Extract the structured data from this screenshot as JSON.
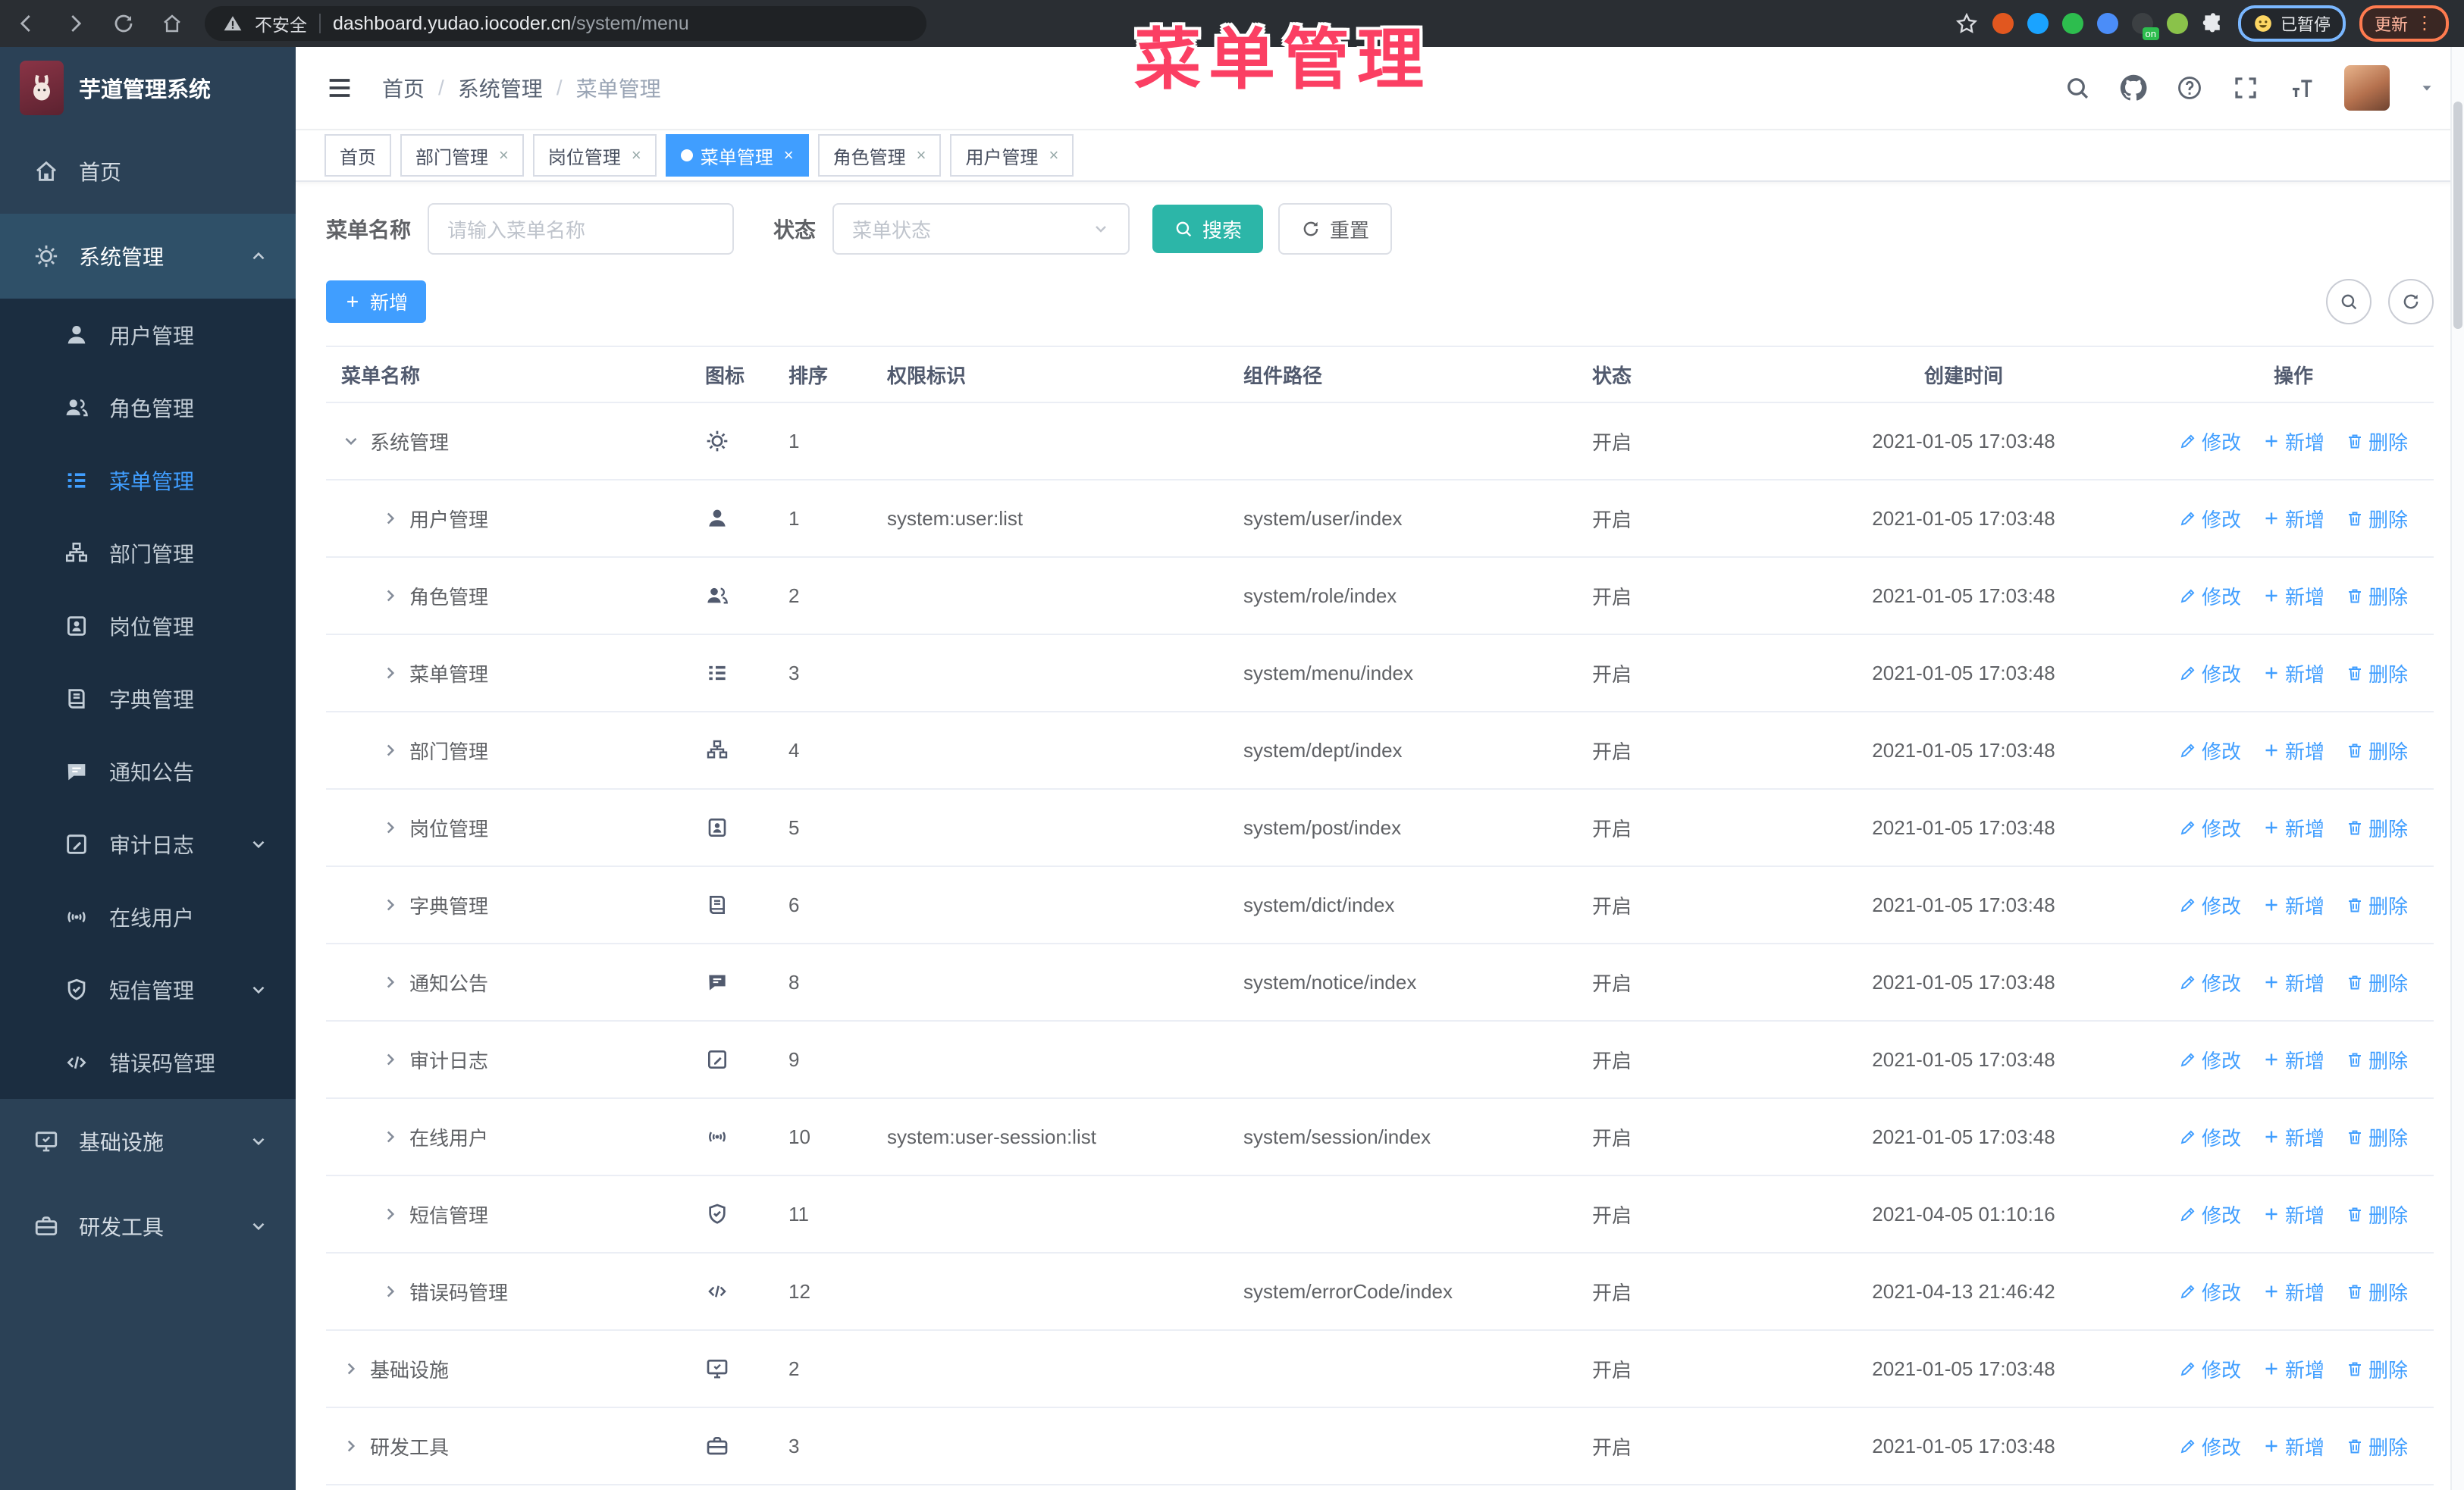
{
  "annotation": {
    "text": "菜单管理"
  },
  "browser": {
    "secure_label": "不安全",
    "url_host": "dashboard.yudao.iocoder.cn",
    "url_path": "/system/menu",
    "paused_label": "已暂停",
    "update_label": "更新",
    "extensions": [
      {
        "name": "ubuntu-extension-icon",
        "color": "#e1571f"
      },
      {
        "name": "gem-extension-icon",
        "color": "#1aa3ff"
      },
      {
        "name": "check-extension-icon",
        "color": "#2dbd4e"
      },
      {
        "name": "tabs-extension-icon",
        "color": "#4b8df8"
      },
      {
        "name": "screenshot-extension-icon",
        "color": "#3c4043",
        "badge": "on"
      },
      {
        "name": "bot-extension-icon",
        "color": "#8ac24a"
      }
    ]
  },
  "sidebar": {
    "app_title": "芋道管理系统",
    "items": [
      {
        "label": "首页",
        "icon": "home",
        "type": "top"
      },
      {
        "label": "系统管理",
        "icon": "gear",
        "type": "top",
        "open": true,
        "chevron": "up"
      },
      {
        "label": "用户管理",
        "icon": "user",
        "type": "sub"
      },
      {
        "label": "角色管理",
        "icon": "users",
        "type": "sub"
      },
      {
        "label": "菜单管理",
        "icon": "menu",
        "type": "sub",
        "active": true
      },
      {
        "label": "部门管理",
        "icon": "tree",
        "type": "sub"
      },
      {
        "label": "岗位管理",
        "icon": "badge",
        "type": "sub"
      },
      {
        "label": "字典管理",
        "icon": "book",
        "type": "sub"
      },
      {
        "label": "通知公告",
        "icon": "chat",
        "type": "sub"
      },
      {
        "label": "审计日志",
        "icon": "editlog",
        "type": "sub",
        "chevron": "down"
      },
      {
        "label": "在线用户",
        "icon": "online",
        "type": "sub"
      },
      {
        "label": "短信管理",
        "icon": "shield",
        "type": "sub",
        "chevron": "down"
      },
      {
        "label": "错误码管理",
        "icon": "code",
        "type": "sub"
      },
      {
        "label": "基础设施",
        "icon": "monitor",
        "type": "top",
        "chevron": "down"
      },
      {
        "label": "研发工具",
        "icon": "tool",
        "type": "top",
        "chevron": "down"
      }
    ]
  },
  "header": {
    "breadcrumb": [
      "首页",
      "系统管理",
      "菜单管理"
    ]
  },
  "tabs": [
    {
      "label": "首页"
    },
    {
      "label": "部门管理",
      "closable": true
    },
    {
      "label": "岗位管理",
      "closable": true
    },
    {
      "label": "菜单管理",
      "closable": true,
      "active": true
    },
    {
      "label": "角色管理",
      "closable": true
    },
    {
      "label": "用户管理",
      "closable": true
    }
  ],
  "filters": {
    "name_label": "菜单名称",
    "name_placeholder": "请输入菜单名称",
    "status_label": "状态",
    "status_placeholder": "菜单状态",
    "search_label": "搜索",
    "reset_label": "重置"
  },
  "toolbar": {
    "add_label": "新增"
  },
  "table": {
    "columns": [
      "菜单名称",
      "图标",
      "排序",
      "权限标识",
      "组件路径",
      "状态",
      "创建时间",
      "操作"
    ],
    "actions": [
      {
        "icon": "pen",
        "label": "修改"
      },
      {
        "icon": "plus",
        "label": "新增"
      },
      {
        "icon": "trash",
        "label": "删除"
      }
    ],
    "rows": [
      {
        "name": "系统管理",
        "icon": "gear",
        "level": 0,
        "caret": "down",
        "sort": "1",
        "perm": "",
        "path": "",
        "status": "开启",
        "time": "2021-01-05 17:03:48"
      },
      {
        "name": "用户管理",
        "icon": "user",
        "level": 1,
        "caret": "right",
        "sort": "1",
        "perm": "system:user:list",
        "path": "system/user/index",
        "status": "开启",
        "time": "2021-01-05 17:03:48"
      },
      {
        "name": "角色管理",
        "icon": "users",
        "level": 1,
        "caret": "right",
        "sort": "2",
        "perm": "",
        "path": "system/role/index",
        "status": "开启",
        "time": "2021-01-05 17:03:48"
      },
      {
        "name": "菜单管理",
        "icon": "menu",
        "level": 1,
        "caret": "right",
        "sort": "3",
        "perm": "",
        "path": "system/menu/index",
        "status": "开启",
        "time": "2021-01-05 17:03:48"
      },
      {
        "name": "部门管理",
        "icon": "tree",
        "level": 1,
        "caret": "right",
        "sort": "4",
        "perm": "",
        "path": "system/dept/index",
        "status": "开启",
        "time": "2021-01-05 17:03:48"
      },
      {
        "name": "岗位管理",
        "icon": "badge",
        "level": 1,
        "caret": "right",
        "sort": "5",
        "perm": "",
        "path": "system/post/index",
        "status": "开启",
        "time": "2021-01-05 17:03:48"
      },
      {
        "name": "字典管理",
        "icon": "book",
        "level": 1,
        "caret": "right",
        "sort": "6",
        "perm": "",
        "path": "system/dict/index",
        "status": "开启",
        "time": "2021-01-05 17:03:48"
      },
      {
        "name": "通知公告",
        "icon": "chat",
        "level": 1,
        "caret": "right",
        "sort": "8",
        "perm": "",
        "path": "system/notice/index",
        "status": "开启",
        "time": "2021-01-05 17:03:48"
      },
      {
        "name": "审计日志",
        "icon": "editlog",
        "level": 1,
        "caret": "right",
        "sort": "9",
        "perm": "",
        "path": "",
        "status": "开启",
        "time": "2021-01-05 17:03:48"
      },
      {
        "name": "在线用户",
        "icon": "online",
        "level": 1,
        "caret": "right",
        "sort": "10",
        "perm": "system:user-session:list",
        "path": "system/session/index",
        "status": "开启",
        "time": "2021-01-05 17:03:48"
      },
      {
        "name": "短信管理",
        "icon": "shield",
        "level": 1,
        "caret": "right",
        "sort": "11",
        "perm": "",
        "path": "",
        "status": "开启",
        "time": "2021-04-05 01:10:16"
      },
      {
        "name": "错误码管理",
        "icon": "code",
        "level": 1,
        "caret": "right",
        "sort": "12",
        "perm": "",
        "path": "system/errorCode/index",
        "status": "开启",
        "time": "2021-04-13 21:46:42"
      },
      {
        "name": "基础设施",
        "icon": "monitor",
        "level": 0,
        "caret": "right",
        "sort": "2",
        "perm": "",
        "path": "",
        "status": "开启",
        "time": "2021-01-05 17:03:48"
      },
      {
        "name": "研发工具",
        "icon": "tool",
        "level": 0,
        "caret": "right",
        "sort": "3",
        "perm": "",
        "path": "",
        "status": "开启",
        "time": "2021-01-05 17:03:48"
      }
    ]
  }
}
